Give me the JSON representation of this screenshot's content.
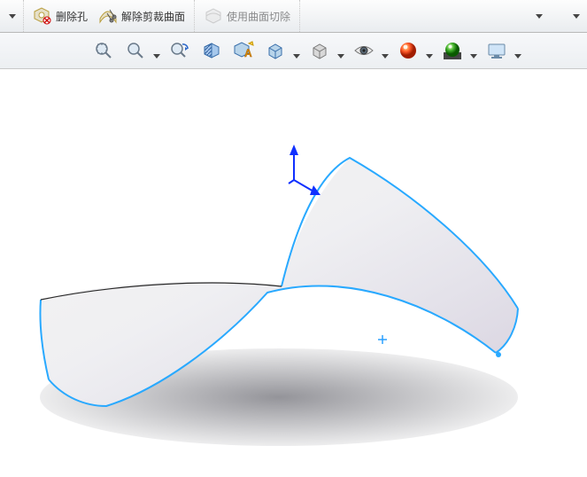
{
  "ribbon": {
    "delete_hole": "删除孔",
    "untrim_surface": "解除剪裁曲面",
    "cut_with_surface": "使用曲面切除"
  },
  "icons": {
    "delete_hole": "delete-hole-icon",
    "untrim_surface": "untrim-surface-icon",
    "cut_with_surface": "cut-with-surface-icon",
    "zoom_fit": "zoom-to-fit-icon",
    "zoom_area": "zoom-to-area-icon",
    "prev_view": "previous-view-icon",
    "section_view": "section-view-icon",
    "dynamic_annotation": "dynamic-annotation-icon",
    "view_orientation": "view-orientation-icon",
    "display_style": "display-style-icon",
    "hide_show": "hide-show-items-icon",
    "edit_appearance": "edit-appearance-icon",
    "apply_scene": "apply-scene-icon",
    "view_settings": "view-settings-icon"
  }
}
